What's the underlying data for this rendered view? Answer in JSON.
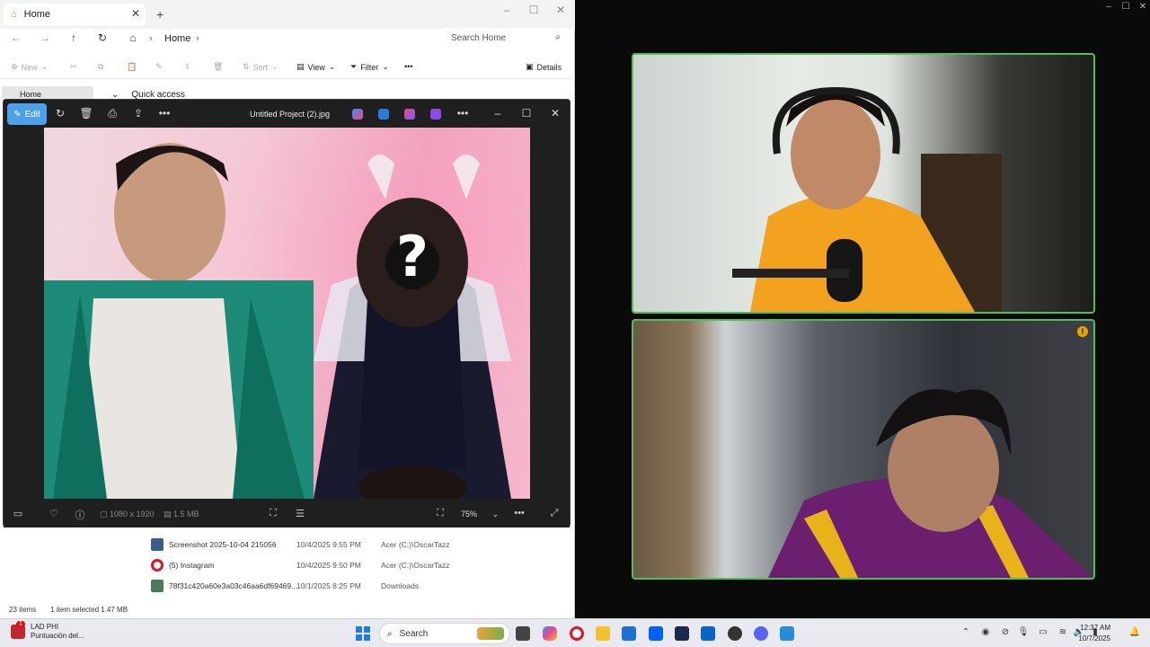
{
  "explorer": {
    "tab_title": "Home",
    "breadcrumb": "Home",
    "search_placeholder": "Search Home",
    "commands": {
      "new": "New",
      "sort": "Sort",
      "view": "View",
      "filter": "Filter",
      "details": "Details"
    },
    "sidebar_home": "Home",
    "quick_access": "Quick access",
    "files": [
      {
        "name": "Screenshot 2025-10-04 215056",
        "date": "10/4/2025 9:55 PM",
        "location": "Acer (C:)\\OscarTazz",
        "icon": "image-thumb-icon",
        "color": "#3a5c8a"
      },
      {
        "name": "(5) Instagram",
        "date": "10/4/2025 9:50 PM",
        "location": "Acer (C:)\\OscarTazz",
        "icon": "opera-icon",
        "color": "#e0162b"
      },
      {
        "name": "78f31c420a60e3a03c46aa6df69469...",
        "date": "10/1/2025 8:25 PM",
        "location": "Downloads",
        "icon": "image-thumb-icon",
        "color": "#4a7a5a"
      }
    ],
    "status": {
      "items": "23 items",
      "selected": "1 item selected  1.47 MB"
    }
  },
  "viewer": {
    "edit_label": "Edit",
    "file_title": "Untitled Project (2).jpg",
    "dimensions": "1080 x 1920",
    "file_size": "1.5 MB",
    "zoom": "75%"
  },
  "taskbar": {
    "weather_temp": "LAD  PHI",
    "weather_desc": "Puntuación del...",
    "search_label": "Search",
    "time": "12:37 AM",
    "date": "10/7/2025",
    "notification_count": "1",
    "pinned": [
      {
        "name": "file-explorer-taskbar-icon",
        "color": "#444444"
      },
      {
        "name": "copilot-taskbar-icon",
        "color": "#7a5cf0"
      },
      {
        "name": "opera-taskbar-icon",
        "color": "#e0162b"
      },
      {
        "name": "folder-taskbar-icon",
        "color": "#f2c12e"
      },
      {
        "name": "store-taskbar-icon",
        "color": "#1f6fd1"
      },
      {
        "name": "dropbox-taskbar-icon",
        "color": "#0061fe"
      },
      {
        "name": "terminal-taskbar-icon",
        "color": "#1b2a4a"
      },
      {
        "name": "outlook-taskbar-icon",
        "color": "#0a64c8"
      },
      {
        "name": "app-taskbar-icon",
        "color": "#333333"
      },
      {
        "name": "discord-taskbar-icon",
        "color": "#5865f2"
      },
      {
        "name": "photos-taskbar-icon",
        "color": "#2a8ad8"
      }
    ]
  },
  "colors": {
    "accent": "#4ca0e8",
    "speaker_border": "#4fbf5a"
  }
}
